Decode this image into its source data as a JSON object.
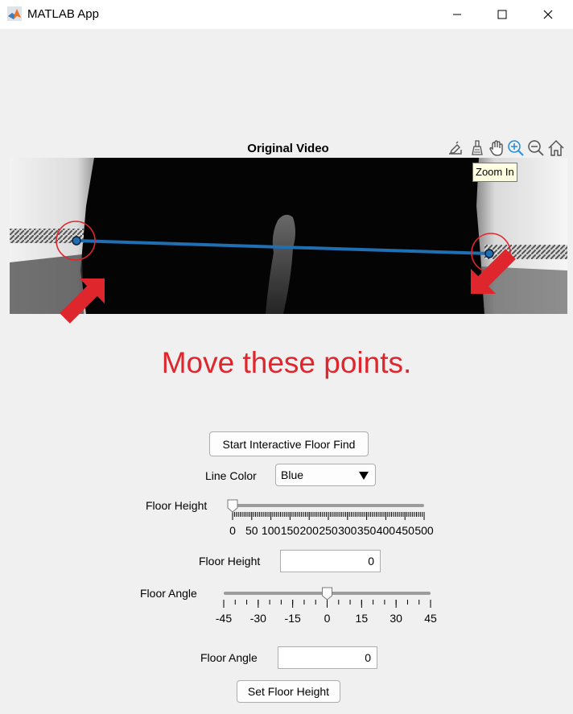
{
  "window": {
    "title": "MATLAB App"
  },
  "axes": {
    "title": "Original Video",
    "tooltip": "Zoom In",
    "toolbar_icons": [
      "brush-export-icon",
      "data-brush-icon",
      "pan-hand-icon",
      "zoom-in-icon",
      "zoom-out-icon",
      "home-icon"
    ]
  },
  "annotation": {
    "instruction": "Move these points.",
    "color": "#e0262d"
  },
  "line": {
    "color": "#1f6fb2"
  },
  "controls": {
    "start_button": "Start Interactive Floor Find",
    "line_color_label": "Line Color",
    "line_color_value": "Blue",
    "floor_height_slider_label": "Floor Height",
    "floor_height_slider": {
      "min": 0,
      "max": 500,
      "value": 0,
      "tick_labels": [
        "0",
        "50",
        "100",
        "150",
        "200",
        "250",
        "300",
        "350",
        "400",
        "450",
        "500"
      ]
    },
    "floor_height_field_label": "Floor Height",
    "floor_height_field_value": "0",
    "floor_angle_slider_label": "Floor Angle",
    "floor_angle_slider": {
      "min": -45,
      "max": 45,
      "value": 0,
      "tick_labels": [
        "-45",
        "-30",
        "-15",
        "0",
        "15",
        "30",
        "45"
      ]
    },
    "floor_angle_field_label": "Floor Angle",
    "floor_angle_field_value": "0",
    "set_button": "Set Floor Height"
  }
}
